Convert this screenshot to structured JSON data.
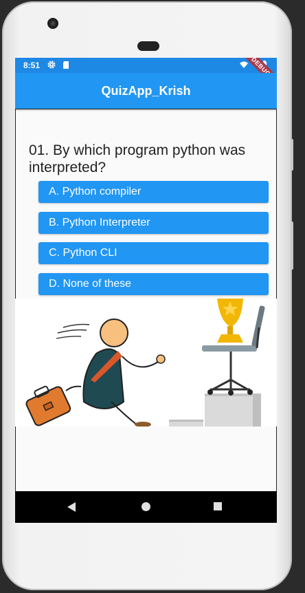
{
  "status_bar": {
    "time": "8:51",
    "left_icons": [
      "gear-icon",
      "sd-card-icon"
    ],
    "right_icons": [
      "wifi-icon",
      "battery-icon"
    ],
    "debug_label": "DEBUG"
  },
  "app_bar": {
    "title": "QuizApp_Krish"
  },
  "question": {
    "text": "01. By which program python was interpreted?"
  },
  "options": [
    {
      "label": "A. Python compiler"
    },
    {
      "label": "B. Python Interpreter"
    },
    {
      "label": "C. Python CLI"
    },
    {
      "label": "D. None of these"
    }
  ],
  "illustration": {
    "description_icon": "climbing-to-trophy-illustration"
  },
  "nav_bar": {
    "icons": [
      "back-icon",
      "home-icon",
      "recent-apps-icon"
    ]
  },
  "colors": {
    "primary": "#2196f3",
    "status_bar": "#1e88e5",
    "debug_ribbon": "#a83a4a",
    "nav_bar": "#000000"
  }
}
